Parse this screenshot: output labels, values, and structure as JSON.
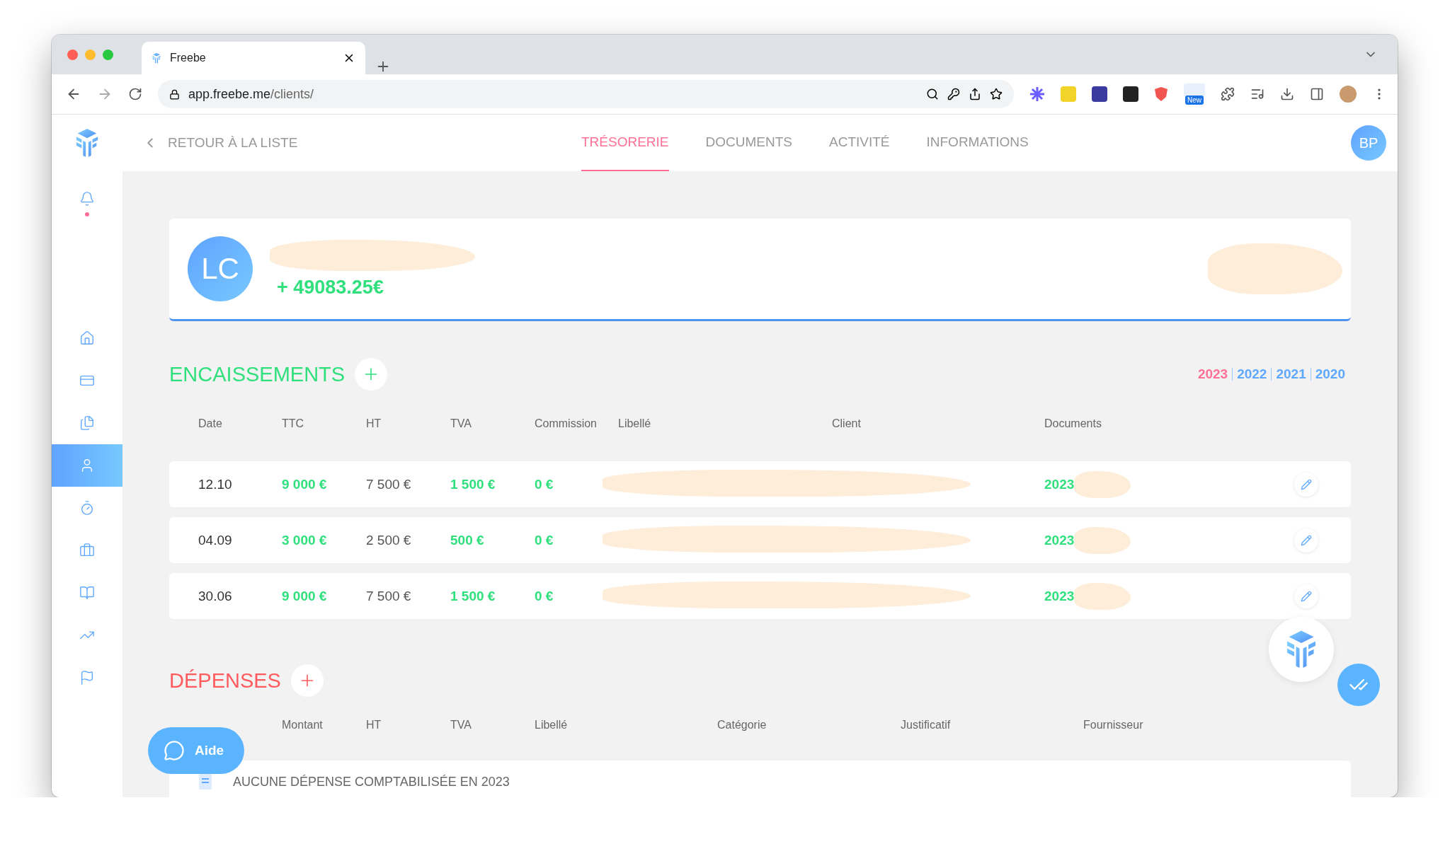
{
  "browser": {
    "tab_title": "Freebe",
    "url_host": "app.freebe.me",
    "url_path": "/clients/",
    "new_badge": "New"
  },
  "sidebar": {
    "items": [
      {
        "kind": "bell",
        "selected": false,
        "unread": true
      },
      {
        "kind": "home",
        "selected": false,
        "unread": false
      },
      {
        "kind": "card",
        "selected": false,
        "unread": false
      },
      {
        "kind": "files",
        "selected": false,
        "unread": false
      },
      {
        "kind": "user",
        "selected": true,
        "unread": false
      },
      {
        "kind": "timer",
        "selected": false,
        "unread": false
      },
      {
        "kind": "briefcase",
        "selected": false,
        "unread": false
      },
      {
        "kind": "book",
        "selected": false,
        "unread": false
      },
      {
        "kind": "chart",
        "selected": false,
        "unread": false
      },
      {
        "kind": "flag",
        "selected": false,
        "unread": false
      }
    ]
  },
  "header": {
    "back_label": "RETOUR À LA LISTE",
    "tabs": [
      {
        "label": "TRÉSORERIE",
        "selected": true
      },
      {
        "label": "DOCUMENTS",
        "selected": false
      },
      {
        "label": "ACTIVITÉ",
        "selected": false
      },
      {
        "label": "INFORMATIONS",
        "selected": false
      }
    ],
    "avatar": "BP"
  },
  "client": {
    "initials": "LC",
    "balance": "+ 49083.25€"
  },
  "encaissements": {
    "title": "ENCAISSEMENTS",
    "years": [
      {
        "label": "2023",
        "selected": true
      },
      {
        "label": "2022",
        "selected": false
      },
      {
        "label": "2021",
        "selected": false
      },
      {
        "label": "2020",
        "selected": false
      }
    ],
    "columns": [
      "Date",
      "TTC",
      "HT",
      "TVA",
      "Commission",
      "Libellé",
      "Client",
      "Documents"
    ],
    "rows": [
      {
        "date": "12.10",
        "ttc": "9 000 €",
        "ht": "7 500 €",
        "tva": "1 500 €",
        "commission": "0 €",
        "document": "2023"
      },
      {
        "date": "04.09",
        "ttc": "3 000 €",
        "ht": "2 500 €",
        "tva": "500 €",
        "commission": "0 €",
        "document": "2023"
      },
      {
        "date": "30.06",
        "ttc": "9 000 €",
        "ht": "7 500 €",
        "tva": "1 500 €",
        "commission": "0 €",
        "document": "2023"
      }
    ]
  },
  "depenses": {
    "title": "DÉPENSES",
    "columns": [
      "Montant",
      "HT",
      "TVA",
      "Libellé",
      "Catégorie",
      "Justificatif",
      "Fournisseur"
    ],
    "empty_message": "AUCUNE DÉPENSE COMPTABILISÉE EN 2023"
  },
  "help_button": {
    "label": "Aide"
  }
}
